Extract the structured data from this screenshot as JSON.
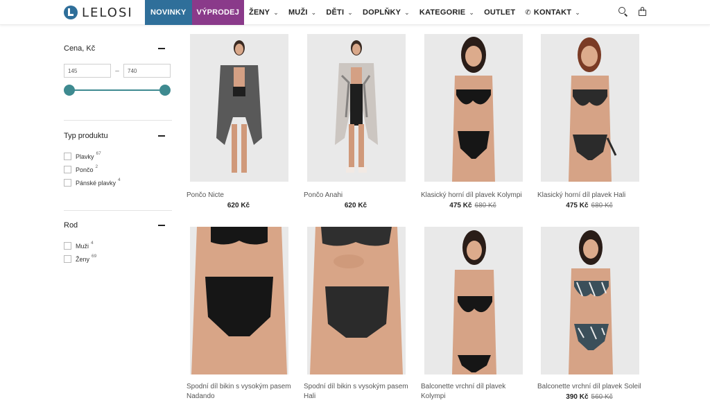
{
  "header": {
    "logo_text": "LELOSI",
    "nav": [
      {
        "label": "NOVINKY",
        "chevron": false,
        "style": "new"
      },
      {
        "label": "VÝPRODEJ",
        "chevron": false,
        "style": "sale"
      },
      {
        "label": "ŽENY",
        "chevron": true
      },
      {
        "label": "MUŽI",
        "chevron": true
      },
      {
        "label": "DĚTI",
        "chevron": true
      },
      {
        "label": "DOPLŇKY",
        "chevron": true
      },
      {
        "label": "KATEGORIE",
        "chevron": true
      },
      {
        "label": "OUTLET",
        "chevron": false
      },
      {
        "label": "KONTAKT",
        "chevron": true,
        "phone": true
      }
    ]
  },
  "colors": {
    "novinky_bg": "#2f6f9a",
    "vyprodej_bg": "#8a3a8a",
    "slider": "#3e8a90",
    "photo_bg": "#e8e8e8"
  },
  "filters": {
    "price": {
      "title": "Cena, Kč",
      "min_value": "145",
      "max_value": "740",
      "separator": "–"
    },
    "product_type": {
      "title": "Typ produktu",
      "options": [
        {
          "label": "Plavky",
          "count": "67"
        },
        {
          "label": "Pončo",
          "count": "2"
        },
        {
          "label": "Pánské plavky",
          "count": "4"
        }
      ]
    },
    "gender": {
      "title": "Rod",
      "options": [
        {
          "label": "Muži",
          "count": "4"
        },
        {
          "label": "Ženy",
          "count": "69"
        }
      ]
    }
  },
  "products": [
    {
      "name": "Pončo Nicte",
      "price": "620 Kč",
      "old_price": ""
    },
    {
      "name": "Pončo Anahi",
      "price": "620 Kč",
      "old_price": ""
    },
    {
      "name": "Klasický horní díl plavek Kolympi",
      "price": "475 Kč",
      "old_price": "680 Kč"
    },
    {
      "name": "Klasický horní díl plavek Hali",
      "price": "475 Kč",
      "old_price": "680 Kč"
    },
    {
      "name": "Spodní díl bikin s vysokým pasem",
      "name2": "Nadando",
      "price": "",
      "old_price": ""
    },
    {
      "name": "Spodní díl bikin s vysokým pasem",
      "name2": "Hali",
      "price": "",
      "old_price": ""
    },
    {
      "name": "Balconette vrchní díl plavek",
      "name2": "Kolympi",
      "price": "",
      "old_price": ""
    },
    {
      "name": "Balconette vrchní díl plavek Soleil",
      "price": "390 Kč",
      "old_price": "560 Kč"
    }
  ]
}
